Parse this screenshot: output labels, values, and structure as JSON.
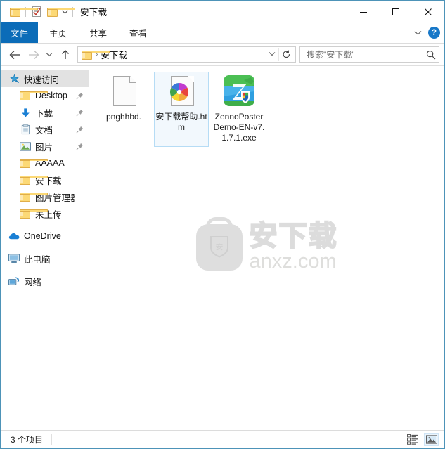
{
  "window": {
    "title": "安下载",
    "quick_access_toolbar": [
      {
        "name": "folder-icon",
        "label": "属性"
      },
      {
        "name": "properties-icon",
        "label": "属性"
      },
      {
        "name": "new-folder-icon",
        "label": "新建文件夹"
      },
      {
        "name": "customize-dropdown-icon",
        "label": "自定义快速访问工具栏"
      }
    ],
    "controls": {
      "minimize": "—",
      "maximize": "□",
      "close": "✕"
    }
  },
  "ribbon": {
    "tabs": [
      {
        "label": "文件",
        "active": true
      },
      {
        "label": "主页",
        "active": false
      },
      {
        "label": "共享",
        "active": false
      },
      {
        "label": "查看",
        "active": false
      }
    ],
    "collapse_icon": "∨",
    "help_label": "?"
  },
  "addressbar": {
    "back_icon": "←",
    "forward_icon": "→",
    "recent_icon": "∨",
    "up_icon": "↑",
    "breadcrumb": [
      "安下载"
    ],
    "breadcrumb_sep": "›",
    "dropdown_icon": "∨",
    "refresh_icon": "↻"
  },
  "search": {
    "placeholder": "搜索\"安下载\"",
    "value": "",
    "icon": "search-icon"
  },
  "sidebar": {
    "items": [
      {
        "label": "快速访问",
        "icon": "star-pin-icon",
        "level": "root",
        "selected": true,
        "pinned": false
      },
      {
        "label": "Desktop",
        "icon": "folder-icon",
        "level": "child",
        "selected": false,
        "pinned": true
      },
      {
        "label": "下载",
        "icon": "download-icon",
        "level": "child",
        "selected": false,
        "pinned": true
      },
      {
        "label": "文档",
        "icon": "documents-icon",
        "level": "child",
        "selected": false,
        "pinned": true
      },
      {
        "label": "图片",
        "icon": "pictures-icon",
        "level": "child",
        "selected": false,
        "pinned": true
      },
      {
        "label": "AAAAA",
        "icon": "folder-icon",
        "level": "child",
        "selected": false,
        "pinned": false
      },
      {
        "label": "安下载",
        "icon": "folder-icon",
        "level": "child",
        "selected": false,
        "pinned": false
      },
      {
        "label": "图片管理器",
        "icon": "folder-icon",
        "level": "child",
        "selected": false,
        "pinned": false
      },
      {
        "label": "未上传",
        "icon": "folder-icon",
        "level": "child",
        "selected": false,
        "pinned": false
      },
      {
        "label": "OneDrive",
        "icon": "onedrive-icon",
        "level": "root",
        "selected": false,
        "pinned": false
      },
      {
        "label": "此电脑",
        "icon": "this-pc-icon",
        "level": "root",
        "selected": false,
        "pinned": false
      },
      {
        "label": "网络",
        "icon": "network-icon",
        "level": "root",
        "selected": false,
        "pinned": false
      }
    ]
  },
  "files": [
    {
      "name": "pnghhbd.",
      "icon": "blank-document-icon",
      "selected": false
    },
    {
      "name": "安下载帮助.htm",
      "icon": "html-chrome-document-icon",
      "selected": true
    },
    {
      "name": "ZennoPosterDemo-EN-v7.1.7.1.exe",
      "icon": "zennoposter-exe-icon",
      "selected": false
    }
  ],
  "watermark": {
    "cn_text": "安下载",
    "en_text": "anxz.com",
    "badge_text": "安",
    "color": "#dedede"
  },
  "statusbar": {
    "item_count": "3 个项目",
    "views": [
      {
        "name": "details-view-button",
        "active": false
      },
      {
        "name": "large-icons-view-button",
        "active": true
      }
    ]
  },
  "colors": {
    "accent": "#0b6cb8",
    "window_border": "#4d93b8",
    "selection_bg": "#f2f8fd",
    "selection_border": "#b6dcf5",
    "sidebar_selected": "#e2e2e2"
  }
}
